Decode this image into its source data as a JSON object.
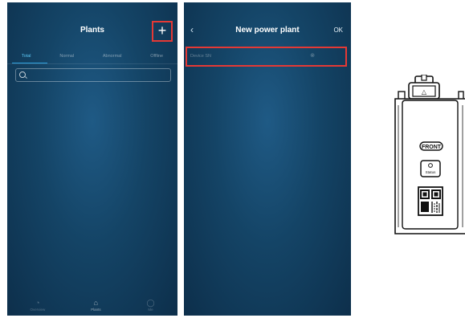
{
  "screen1": {
    "status": {
      "time": "",
      "icons": ""
    },
    "title": "Plants",
    "add_label": "+",
    "tabs": [
      {
        "label": "Total",
        "active": true
      },
      {
        "label": "Normal",
        "active": false
      },
      {
        "label": "Abnormal",
        "active": false
      },
      {
        "label": "Offline",
        "active": false
      }
    ],
    "search_placeholder": "",
    "nav": [
      {
        "label": "Overview",
        "icon": "overview-icon",
        "glyph": "◔",
        "active": false
      },
      {
        "label": "Plants",
        "icon": "plants-icon",
        "glyph": "⌂",
        "active": true
      },
      {
        "label": "Me",
        "icon": "me-icon",
        "glyph": "◯",
        "active": false
      }
    ]
  },
  "screen2": {
    "title": "New power plant",
    "back_label": "‹",
    "ok_label": "OK",
    "input_placeholder": "Device SN",
    "clear_glyph": "⊗"
  },
  "device": {
    "front_label": "FRONT",
    "status_label": "Status",
    "delta_glyph": "△"
  },
  "accent_colors": {
    "highlight": "#e53935",
    "active_tab": "#5cc7f5",
    "background": "#144466"
  }
}
